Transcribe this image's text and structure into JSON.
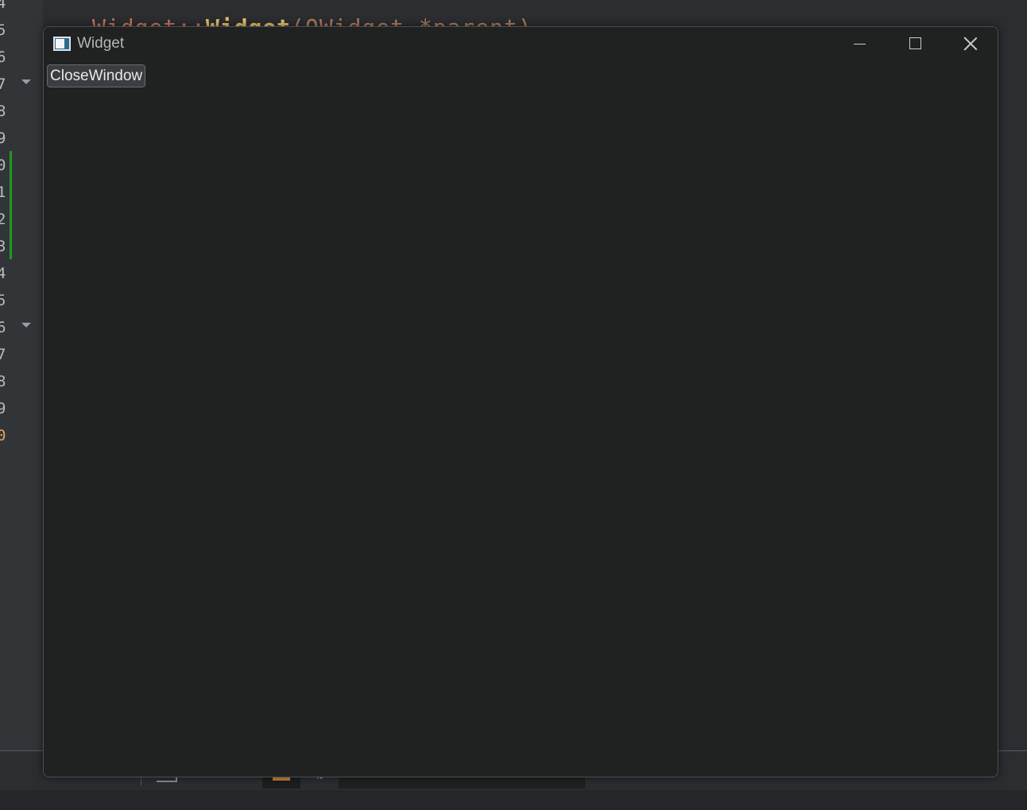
{
  "ide": {
    "gutter_line_numbers": [
      "4",
      "5",
      "6",
      "7",
      "8",
      "9",
      "0",
      "1",
      "2",
      "3",
      "4",
      "5",
      "6",
      "7",
      "8",
      "9",
      "0"
    ],
    "code_line": {
      "class_part": "Widget::",
      "fn_part": "Widget",
      "rest_part": "(QWidget *parent)"
    },
    "colors": {
      "change_bar": "#1f9a1f",
      "warning_line_number": "#e0a35a"
    }
  },
  "window": {
    "title": "Widget",
    "icon": "qt-app-window-icon",
    "controls": {
      "minimize_icon": "minimize-icon",
      "maximize_icon": "maximize-icon",
      "close_icon": "close-icon"
    },
    "button_label": "CloseWindow",
    "background": "#202121"
  }
}
